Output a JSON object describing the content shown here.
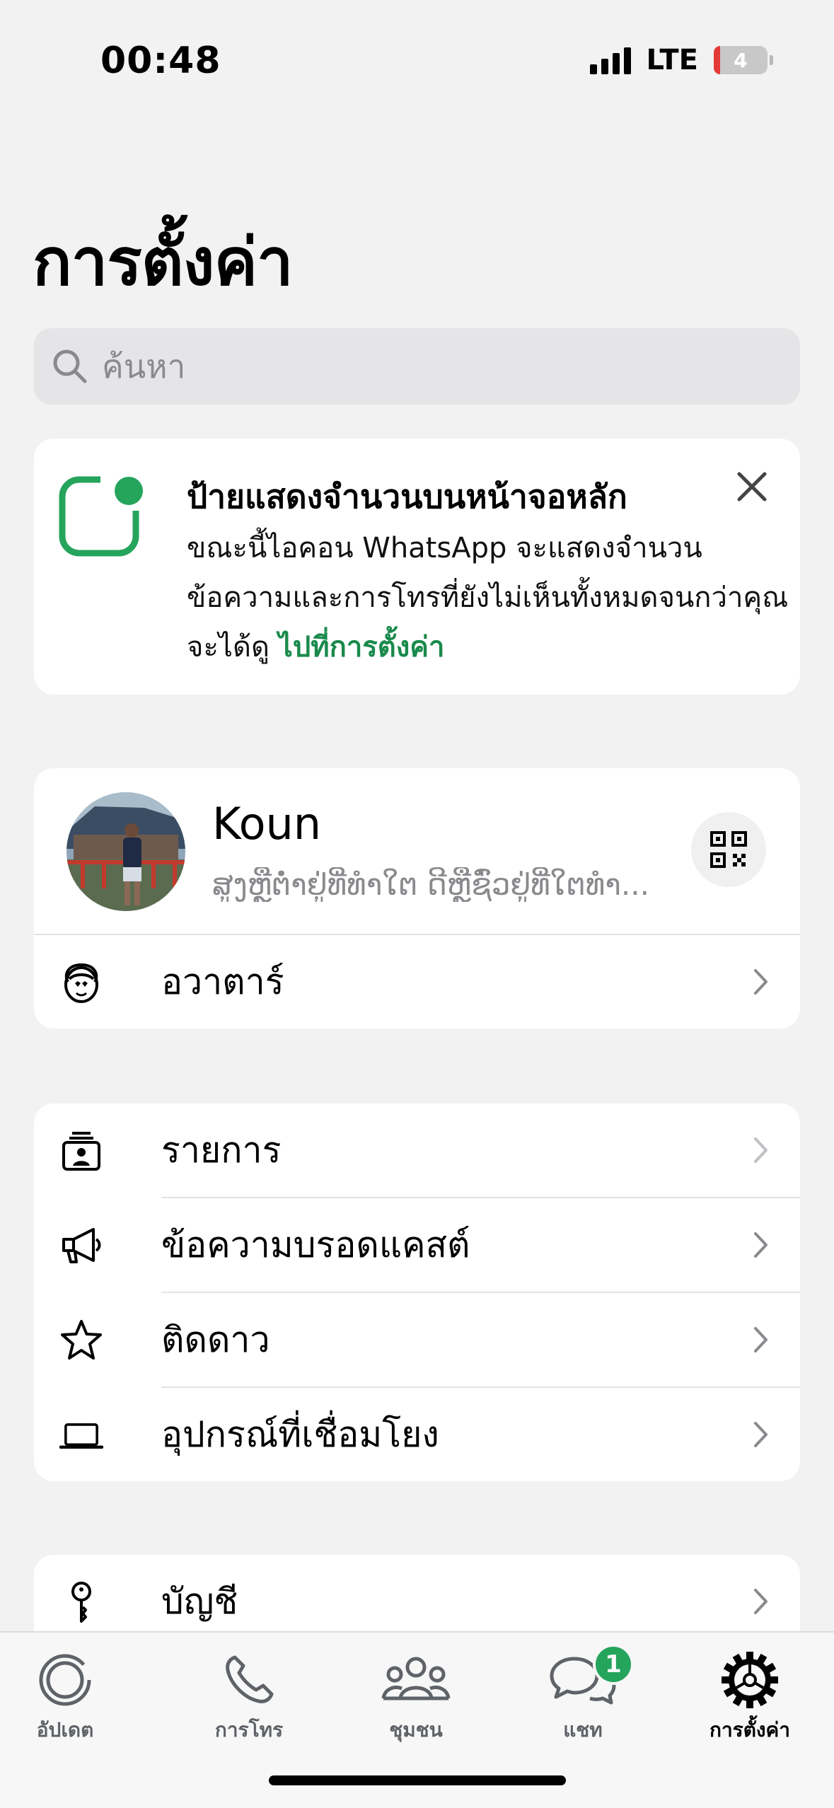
{
  "status_bar": {
    "time": "00:48",
    "network": "LTE",
    "battery": "4"
  },
  "title": "การตั้งค่า",
  "search": {
    "placeholder": "ค้นหา"
  },
  "notice": {
    "title": "ป้ายแสดงจำนวนบนหน้าจอหลัก",
    "body": "ขณะนี้ไอคอน WhatsApp จะแสดงจำนวนข้อความและการโทรที่ยังไม่เห็นทั้งหมดจนกว่าคุณจะได้ดู ",
    "link": "ไปที่การตั้งค่า"
  },
  "profile": {
    "name": "Koun",
    "status": "ສູງຫຼືຕ່ຳຢູ່ທີ່ທຳໃຕ ດີຫຼືຊົ່ວຢູ່ທີ່ໃຕທຳ..."
  },
  "avatar_row": {
    "label": "อวาตาร์",
    "icon": "avatar-face-icon"
  },
  "list1": [
    {
      "label": "รายการ",
      "icon": "lists-icon"
    },
    {
      "label": "ข้อความบรอดแคสต์",
      "icon": "megaphone-icon"
    },
    {
      "label": "ติดดาว",
      "icon": "star-icon"
    },
    {
      "label": "อุปกรณ์ที่เชื่อมโยง",
      "icon": "laptop-icon"
    }
  ],
  "list2": [
    {
      "label": "บัญชี",
      "icon": "key-icon"
    }
  ],
  "tabs": [
    {
      "label": "อัปเดต",
      "icon": "updates-icon"
    },
    {
      "label": "การโทร",
      "icon": "phone-icon"
    },
    {
      "label": "ชุมชน",
      "icon": "communities-icon"
    },
    {
      "label": "แชท",
      "icon": "chat-icon",
      "badge": "1"
    },
    {
      "label": "การตั้งค่า",
      "icon": "settings-gear-icon",
      "active": true
    }
  ],
  "colors": {
    "accent": "#1a8a4c",
    "badge": "#25a45c",
    "background": "#f2f2f2"
  }
}
